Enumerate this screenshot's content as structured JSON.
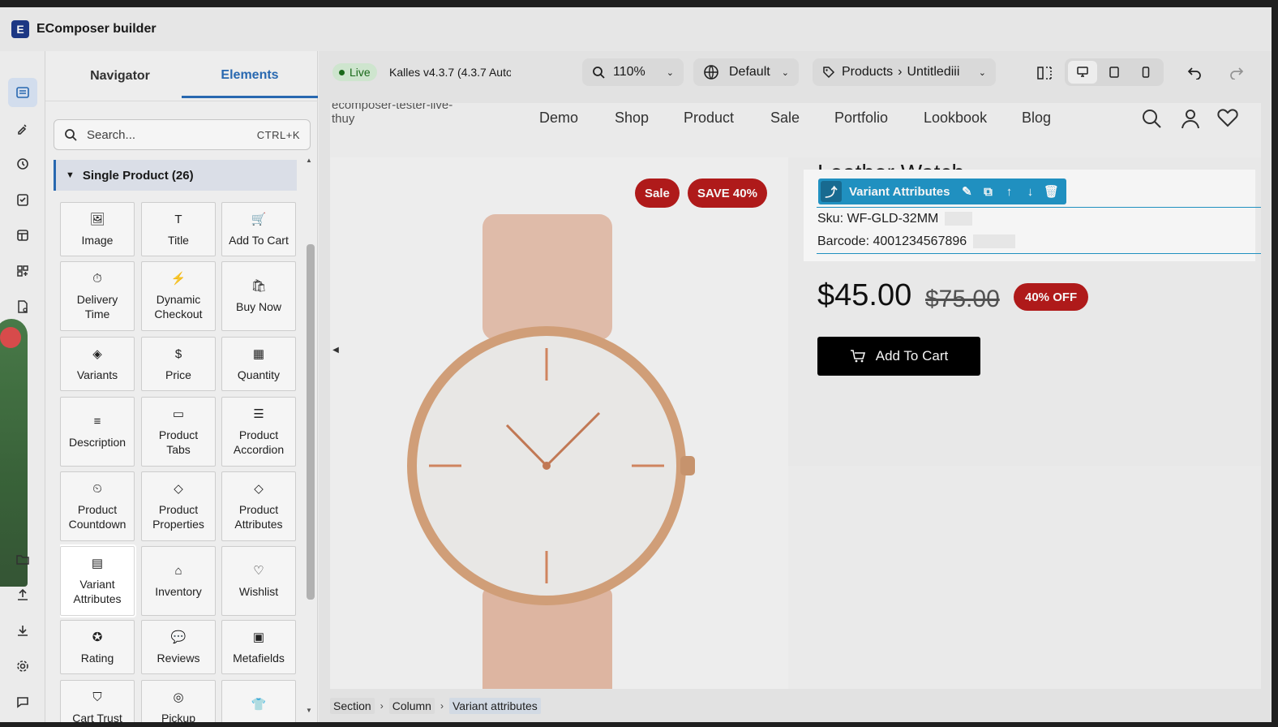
{
  "app": {
    "title": "EComposer builder"
  },
  "sidebar": {
    "tabs": [
      "Navigator",
      "Elements"
    ],
    "active_tab": "Elements",
    "search": {
      "placeholder": "Search...",
      "shortcut": "CTRL+K"
    },
    "category": "Single Product (26)",
    "elements": [
      {
        "label": "Image",
        "icon": "image-icon"
      },
      {
        "label": "Title",
        "icon": "title-icon"
      },
      {
        "label": "Add To Cart",
        "icon": "cart-plus-icon"
      },
      {
        "label": "Delivery Time",
        "icon": "clock-icon"
      },
      {
        "label": "Dynamic Checkout",
        "icon": "checkout-icon"
      },
      {
        "label": "Buy Now",
        "icon": "buy-now-icon"
      },
      {
        "label": "Variants",
        "icon": "variants-icon"
      },
      {
        "label": "Price",
        "icon": "price-icon"
      },
      {
        "label": "Quantity",
        "icon": "quantity-icon"
      },
      {
        "label": "Description",
        "icon": "description-icon"
      },
      {
        "label": "Product Tabs",
        "icon": "tabs-icon"
      },
      {
        "label": "Product Accordion",
        "icon": "accordion-icon"
      },
      {
        "label": "Product Countdown",
        "icon": "countdown-icon"
      },
      {
        "label": "Product Properties",
        "icon": "tag-icon"
      },
      {
        "label": "Product Attributes",
        "icon": "tag-list-icon"
      },
      {
        "label": "Variant Attributes",
        "icon": "variant-attributes-icon"
      },
      {
        "label": "Inventory",
        "icon": "inventory-icon"
      },
      {
        "label": "Wishlist",
        "icon": "heart-icon"
      },
      {
        "label": "Rating",
        "icon": "star-icon"
      },
      {
        "label": "Reviews",
        "icon": "reviews-icon"
      },
      {
        "label": "Metafields",
        "icon": "metafields-icon"
      },
      {
        "label": "Cart Trust",
        "icon": "shield-icon"
      },
      {
        "label": "Pickup",
        "icon": "pickup-icon"
      },
      {
        "label": "",
        "icon": "shirt-icon"
      }
    ],
    "selected_element": "Variant Attributes"
  },
  "toolbar": {
    "live_label": "Live",
    "theme": "Kalles v4.3.7 (4.3.7 Auto...",
    "zoom": "110%",
    "language": "Default",
    "page_type": "Products",
    "page_name": "Untitlediii"
  },
  "storefront": {
    "brand": "ecomposer-tester-live-thuy",
    "nav": [
      "Demo",
      "Shop",
      "Product",
      "Sale",
      "Portfolio",
      "Lookbook",
      "Blog"
    ],
    "product": {
      "title": "Leather Watch",
      "badges": [
        "Sale",
        "SAVE 40%"
      ],
      "sku": "Sku: WF-GLD-32MM",
      "barcode": "Barcode: 4001234567896",
      "price": "$45.00",
      "compare_price": "$75.00",
      "discount": "40% OFF",
      "add_to_cart": "Add To Cart"
    },
    "selected_block": "Variant Attributes"
  },
  "breadcrumb": [
    "Section",
    "Column",
    "Variant attributes"
  ],
  "colors": {
    "accent": "#2a6db8",
    "selection": "#2296c8",
    "sale": "#b71c1c"
  }
}
